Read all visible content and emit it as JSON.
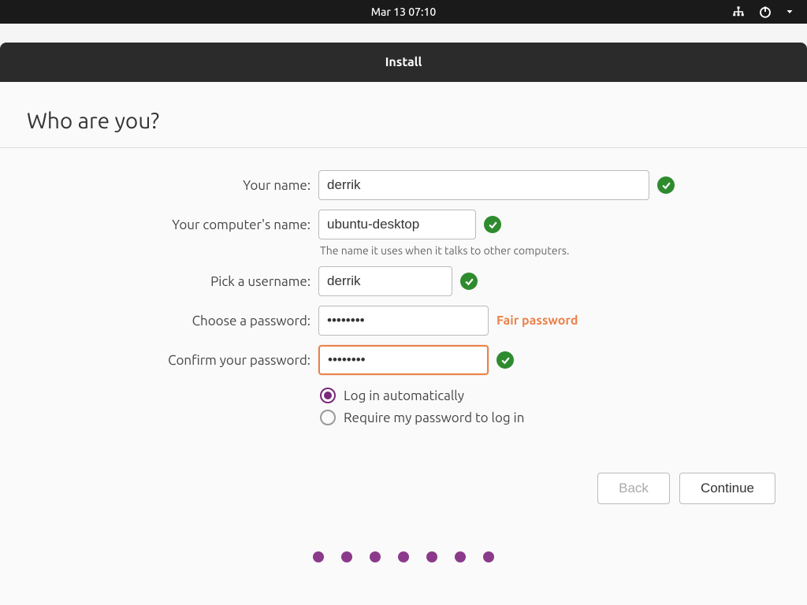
{
  "topbar": {
    "clock": "Mar 13  07:10"
  },
  "window": {
    "title": "Install"
  },
  "page": {
    "heading": "Who are you?"
  },
  "form": {
    "name": {
      "label": "Your name:",
      "value": "derrik"
    },
    "computer": {
      "label": "Your computer's name:",
      "value": "ubuntu-desktop",
      "hint": "The name it uses when it talks to other computers."
    },
    "username": {
      "label": "Pick a username:",
      "value": "derrik"
    },
    "password": {
      "label": "Choose a password:",
      "value": "••••••••",
      "strength": "Fair password"
    },
    "confirm": {
      "label": "Confirm your password:",
      "value": "••••••••"
    },
    "login_auto": {
      "label": "Log in automatically",
      "selected": true
    },
    "login_require": {
      "label": "Require my password to log in",
      "selected": false
    }
  },
  "buttons": {
    "back": "Back",
    "continue": "Continue"
  },
  "progress": {
    "steps": 7
  }
}
